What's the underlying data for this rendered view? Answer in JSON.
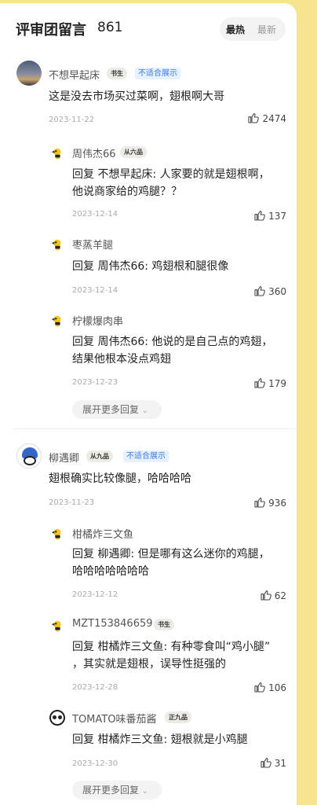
{
  "header": {
    "title": "评审团留言",
    "count": "861",
    "sort_hot": "最热",
    "sort_new": "最新"
  },
  "thread1": {
    "user": "不想早起床",
    "rank": "书生",
    "flag": "不适合展示",
    "text": "这是没去市场买过菜啊，翅根啊大哥",
    "date": "2023-11-22",
    "likes": "2474",
    "replies": [
      {
        "user": "周伟杰66",
        "rank": "从六品",
        "line1": "回复  不想早起床: 人家要的就是翅根啊，",
        "line2": "他说商家给的鸡腿？？",
        "date": "2023-12-14",
        "likes": "137"
      },
      {
        "user": "枣蒸羊腿",
        "line1": "回复  周伟杰66: 鸡翅根和腿很像",
        "date": "2023-12-14",
        "likes": "360"
      },
      {
        "user": "柠檬爆肉串",
        "line1": "回复  周伟杰66: 他说的是自己点的鸡翅，",
        "line2": "结果他根本没点鸡翅",
        "date": "2023-12-23",
        "likes": "179"
      }
    ],
    "more": "展开更多回复"
  },
  "thread2": {
    "user": "柳遇卿",
    "rank": "从九品",
    "flag": "不适合展示",
    "text": "翅根确实比较像腿，哈哈哈哈",
    "date": "2023-11-23",
    "likes": "936",
    "replies": [
      {
        "user": "柑橘炸三文鱼",
        "line1": "回复  柳遇卿: 但是哪有这么迷你的鸡腿，",
        "line2": "哈哈哈哈哈哈哈",
        "date": "2023-12-12",
        "likes": "62"
      },
      {
        "user": "MZT153846659",
        "rank": "书生",
        "line1": "回复  柑橘炸三文鱼: 有种零食叫“鸡小腿”",
        "line2": "，其实就是翅根，误导性挺强的",
        "date": "2023-12-28",
        "likes": "106"
      },
      {
        "user": "TOMATO味番茄酱",
        "rank": "正九品",
        "line1": "回复  柑橘炸三文鱼: 翅根就是小鸡腿",
        "date": "2023-12-30",
        "likes": "31"
      }
    ],
    "more": "展开更多回复"
  }
}
